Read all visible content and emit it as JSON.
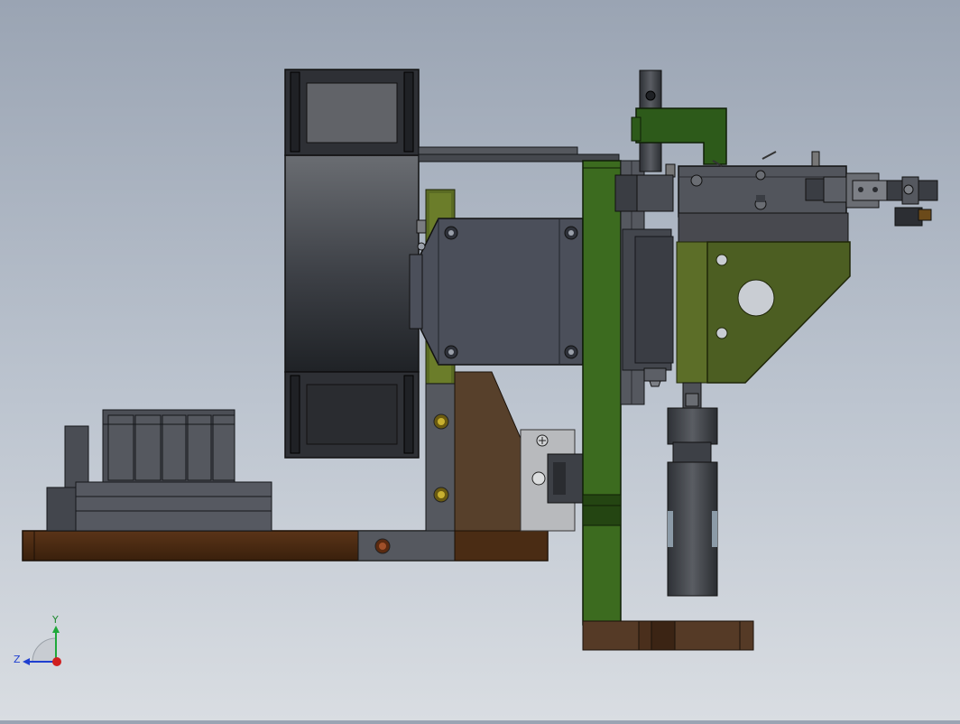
{
  "view": {
    "background_top": "#9aa4b3",
    "background_bottom": "#d9dde2"
  },
  "triad": {
    "y_label": "Y",
    "z_label": "Z",
    "y_color": "#1fa83a",
    "z_color": "#1f3fd0",
    "x_color": "#d01f1f"
  },
  "colors": {
    "dark_steel": "#4a4d55",
    "gray_block": "#555860",
    "motor_gray": "#4b4f5a",
    "green_plate": "#3c6b1f",
    "olive_plate": "#5c6e28",
    "olive_light": "#7a8a2a",
    "brown_base": "#4a2c14",
    "brown_block": "#553a26",
    "silver": "#b9bbbe"
  }
}
